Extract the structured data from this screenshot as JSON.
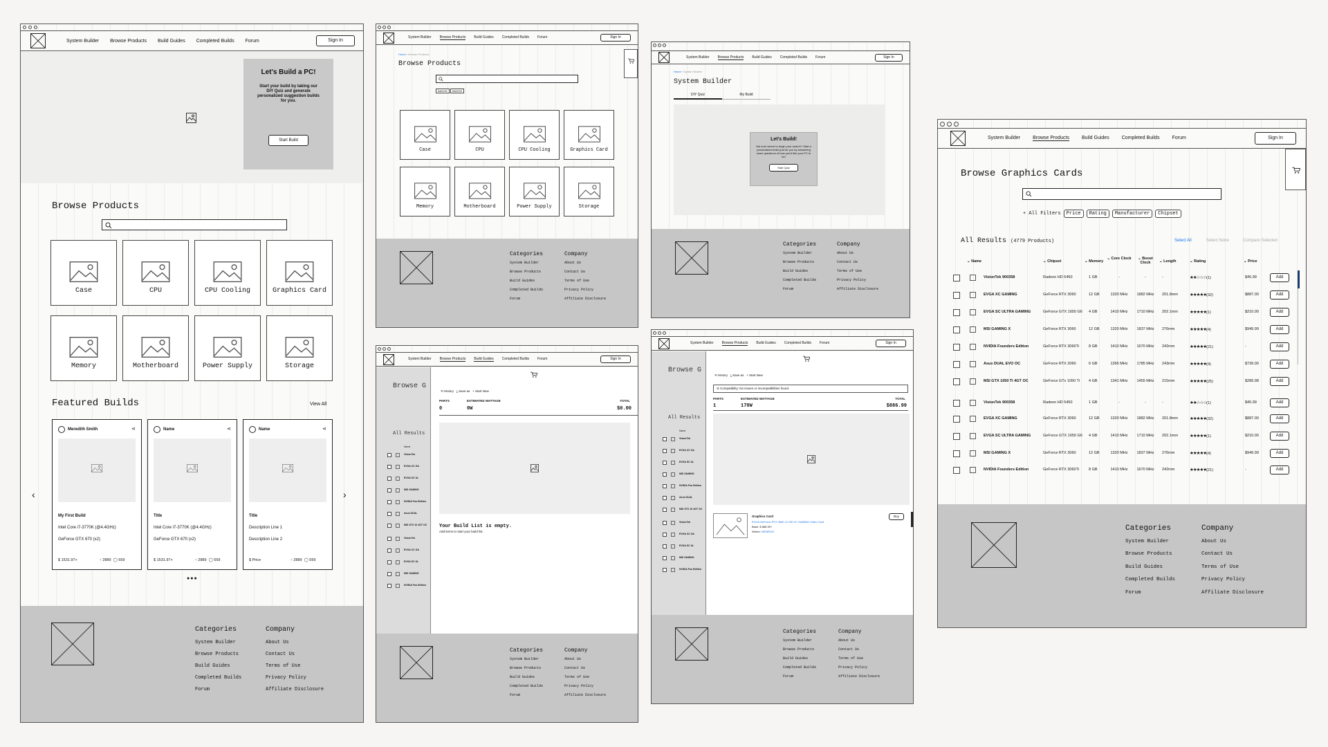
{
  "nav": {
    "items": [
      "System Builder",
      "Browse Products",
      "Build Guides",
      "Completed Builds",
      "Forum"
    ],
    "sign_in": "Sign In"
  },
  "footer": {
    "categories_title": "Categories",
    "categories": [
      "System Builder",
      "Browse Products",
      "Build Guides",
      "Completed Builds",
      "Forum"
    ],
    "company_title": "Company",
    "company": [
      "About Us",
      "Contact Us",
      "Terms of Use",
      "Privacy Policy",
      "Affiliate Disclosure"
    ]
  },
  "home": {
    "hero_title": "Let's Build a PC!",
    "hero_text": "Start your build by taking our DIY Quiz and generate personalized suggestion builds for you.",
    "hero_button": "Start Build",
    "browse_title": "Browse Products",
    "categories": [
      "Case",
      "CPU",
      "CPU Cooling",
      "Graphics Card",
      "Memory",
      "Motherboard",
      "Power Supply",
      "Storage"
    ],
    "featured_title": "Featured Builds",
    "view_all": "View All",
    "builds": [
      {
        "author": "Meredith Smith",
        "title": "My First Build",
        "line1": "Intel Core i7-3770K (@4.4GHz)",
        "line2": "GeForce GTX 670 (x2)",
        "price": "$ 1531.97+",
        "likes": "2889",
        "comments": "559"
      },
      {
        "author": "Name",
        "title": "Title",
        "line1": "Intel Core i7-3770K (@4.4GHz)",
        "line2": "GeForce GTX 670 (x2)",
        "price": "$ 1531.97+",
        "likes": "2889",
        "comments": "559"
      },
      {
        "author": "Name",
        "title": "Title",
        "line1": "Description Line 1",
        "line2": "Description Line 2",
        "price": "$ Price",
        "likes": "2889",
        "comments": "559"
      }
    ],
    "dots": "●●●"
  },
  "browse": {
    "crumb_home": "Home",
    "crumb_current": "Browse Products",
    "title": "Browse Products",
    "badges": [
      "BADGE",
      "BADGE"
    ],
    "categories": [
      "Case",
      "CPU",
      "CPU Cooling",
      "Graphics Card",
      "Memory",
      "Motherboard",
      "Power Supply",
      "Storage"
    ]
  },
  "builder": {
    "crumb_home": "Home",
    "crumb_current": "System Builder",
    "title": "System Builder",
    "tabs": [
      "DIY Quiz",
      "My Build"
    ],
    "card_title": "Let's Build!",
    "card_text": "Not sure where to begin your search? Start a personalized build just for you by answering some questions of how you'd like your PC to be!",
    "card_button": "Start Quiz"
  },
  "drawer_empty": {
    "bg_title": "Browse G",
    "bg_results": "All Results",
    "bg_name_header": "Name",
    "bg_rows": [
      "VisionTek",
      "EVGA XC GA",
      "EVGA SC UL",
      "MSI GAMING",
      "NVIDIA Fou Edition",
      "Asus DUAL",
      "MSI GTX 10 4GT OC",
      "VisionTek",
      "EVGA XC GA",
      "EVGA SC UL",
      "MSI GAMING",
      "NVIDIA Fou Edition"
    ],
    "tools": [
      "History",
      "Save as",
      "Start New"
    ],
    "parts_label": "PARTS",
    "parts_value": "0",
    "wattage_label": "ESTIMATED WATTAGE",
    "wattage_value": "0W",
    "total_label": "TOTAL",
    "total_value": "$0.00",
    "empty_title": "Your Build List is empty.",
    "empty_text": "Add items to start your build list."
  },
  "drawer_full": {
    "bg_title": "Browse G",
    "bg_results": "All Results",
    "bg_name_header": "Name",
    "bg_rows": [
      "VisionTek",
      "EVGA XC GA",
      "EVGA SC UL",
      "MSI GAMING",
      "NVIDIA Fou Edition",
      "Asus DUAL",
      "MSI GTX 10 4GT OC",
      "VisionTek",
      "EVGA XC GA",
      "EVGA SC UL",
      "MSI GAMING",
      "NVIDIA Fou Edition"
    ],
    "tools": [
      "History",
      "Save as",
      "Start New"
    ],
    "compat": "Compatibility: No issues or incompatibilities found.",
    "parts_label": "PARTS",
    "parts_value": "1",
    "wattage_label": "ESTIMATED WATTAGE",
    "wattage_value": "170W",
    "total_label": "TOTAL",
    "total_value": "$886.99",
    "item_category": "Graphics Card",
    "item_name": "EVGA GeForce RTX 3060 12 GB XC GAMING Video Card",
    "item_base": "Base: $ 886.99+",
    "item_where_label": "Where:",
    "item_where_value": "NEWEGG",
    "buy": "Buy"
  },
  "gfx": {
    "title": "Browse Graphics Cards",
    "filters_label": "All Filters",
    "filters": [
      "Price",
      "Rating",
      "Manufacturer",
      "Chipset"
    ],
    "results_label": "All Results",
    "results_count": "(4779 Products)",
    "select_all": "Select All",
    "select_none": "Select None",
    "compare": "Compare Selected",
    "columns": [
      "Name",
      "Chipset",
      "Memory",
      "Core Clock",
      "Boost Clock",
      "Length",
      "Rating",
      "Price"
    ],
    "add_label": "Add",
    "rows": [
      {
        "name": "VisionTek 900358",
        "chipset": "Radeon HD 5450",
        "memory": "1 GB",
        "core": "-",
        "boost": "-",
        "length": "-",
        "stars": "★★☆☆☆",
        "count": "(1)",
        "price": "$45.99"
      },
      {
        "name": "EVGA XC GAMING",
        "chipset": "GeForce RTX 3060",
        "memory": "12 GB",
        "core": "1320 MHz",
        "boost": "1882 MHz",
        "length": "201.8mm",
        "stars": "★★★★★",
        "count": "(32)",
        "price": "$887.00"
      },
      {
        "name": "EVGA SC ULTRA GAMING",
        "chipset": "GeForce GTX 1650 G6",
        "memory": "4 GB",
        "core": "1410 MHz",
        "boost": "1710 MHz",
        "length": "202.1mm",
        "stars": "★★★★★",
        "count": "(1)",
        "price": "$210.00"
      },
      {
        "name": "MSI GAMING X",
        "chipset": "GeForce RTX 3060",
        "memory": "12 GB",
        "core": "1320 MHz",
        "boost": "1837 MHz",
        "length": "276mm",
        "stars": "★★★★★",
        "count": "(4)",
        "price": "$949.99"
      },
      {
        "name": "NVIDIA Founders Edition",
        "chipset": "GeForce RTX 3060Ti",
        "memory": "8 GB",
        "core": "1410 MHz",
        "boost": "1670 MHz",
        "length": "242mm",
        "stars": "★★★★★",
        "count": "(21)",
        "price": "-"
      },
      {
        "name": "Asus DUAL EVO OC",
        "chipset": "GeForce RTX 2060",
        "memory": "6 GB",
        "core": "1365 MHz",
        "boost": "1785 MHz",
        "length": "243mm",
        "stars": "★★★★★",
        "count": "(4)",
        "price": "$739.00"
      },
      {
        "name": "MSI GTX 1050 Ti 4GT OC",
        "chipset": "GeForce GTx 1050 Ti",
        "memory": "4 GB",
        "core": "1341 MHz",
        "boost": "1455 MHz",
        "length": "215mm",
        "stars": "★★★★★",
        "count": "(25)",
        "price": "$289.98"
      },
      {
        "name": "VisionTek 900358",
        "chipset": "Radeon HD 5450",
        "memory": "1 GB",
        "core": "-",
        "boost": "-",
        "length": "-",
        "stars": "★★☆☆☆",
        "count": "(1)",
        "price": "$45.99"
      },
      {
        "name": "EVGA XC GAMING",
        "chipset": "GeForce RTX 3060",
        "memory": "12 GB",
        "core": "1320 MHz",
        "boost": "1882 MHz",
        "length": "201.8mm",
        "stars": "★★★★★",
        "count": "(32)",
        "price": "$887.00"
      },
      {
        "name": "EVGA SC ULTRA GAMING",
        "chipset": "GeForce GTX 1650 G6",
        "memory": "4 GB",
        "core": "1410 MHz",
        "boost": "1710 MHz",
        "length": "202.1mm",
        "stars": "★★★★★",
        "count": "(1)",
        "price": "$210.00"
      },
      {
        "name": "MSI GAMING X",
        "chipset": "GeForce RTX 3060",
        "memory": "12 GB",
        "core": "1320 MHz",
        "boost": "1837 MHz",
        "length": "276mm",
        "stars": "★★★★★",
        "count": "(4)",
        "price": "$949.99"
      },
      {
        "name": "NVIDIA Founders Edition",
        "chipset": "GeForce RTX 3060Ti",
        "memory": "8 GB",
        "core": "1410 MHz",
        "boost": "1670 MHz",
        "length": "242mm",
        "stars": "★★★★★",
        "count": "(21)",
        "price": "-"
      }
    ]
  }
}
